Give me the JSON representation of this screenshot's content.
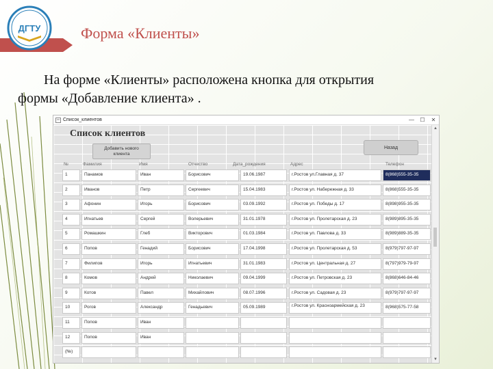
{
  "slide": {
    "logo_text": "ДГТУ",
    "title": "Форма «Клиенты»",
    "body_line1": "На форме «Клиенты» расположена кнопка для открытия",
    "body_line2": "формы «Добавление клиента» ."
  },
  "window": {
    "title": "Список_клиентов",
    "controls": {
      "minimize": "—",
      "maximize": "☐",
      "close": "✕"
    }
  },
  "form": {
    "caption": "Список клиентов",
    "add_button": "Добавить нового клиента",
    "back_button": "Назад",
    "columns": [
      "№",
      "Фамилия",
      "Имя",
      "Отчество",
      "Дата_рождения",
      "Адрес",
      "Телефон"
    ],
    "rows": [
      [
        "1",
        "Панамов",
        "Иван",
        "Борисович",
        "19.06.1987",
        "г.Ростов ул.Главная д. 37",
        "8(868)555-35-35"
      ],
      [
        "2",
        "Иванов",
        "Петр",
        "Сергеевич",
        "15.04.1983",
        "г.Ростов ул. Набережная д. 33",
        "8(868)555-35-35"
      ],
      [
        "3",
        "Афонин",
        "Игорь",
        "Борисович",
        "03.09.1992",
        "г.Ростов ул. Победы д. 17",
        "8(898)955-35-35"
      ],
      [
        "4",
        "Игнатьев",
        "Сергей",
        "Волерьевич",
        "31.01.1978",
        "г.Ростов ул. Пролетарская д. 23",
        "8(989)895-35-35"
      ],
      [
        "5",
        "Ромашкин",
        "Глеб",
        "Викторович",
        "01.03.1984",
        "г.Ростов ул. Павлова д. 33",
        "8(989)889-35-35"
      ],
      [
        "6",
        "Попов",
        "Генадий",
        "Борисович",
        "17.04.1998",
        "г.Ростов ул. Пролетарская д. 53",
        "8(979)797-97-97"
      ],
      [
        "7",
        "Филипов",
        "Игорь",
        "Игнатьевич",
        "31.01.1983",
        "г.Ростов ул. Центральная д. 27",
        "8(797)979-79-97"
      ],
      [
        "8",
        "Комов",
        "Андрей",
        "Николаевич",
        "09.04.1999",
        "г.Ростов ул. Петровская д. 23",
        "8(868)646-84-46"
      ],
      [
        "9",
        "Котов",
        "Павел",
        "Михайлович",
        "08.07.1996",
        "г.Ростов ул. Садовая д. 23",
        "8(979)797-97-97"
      ],
      [
        "10",
        "Рогов",
        "Александр",
        "Генадьевич",
        "05.09.1989",
        "г.Ростов ул. Красноармейская д. 23",
        "8(968)575-77-58"
      ],
      [
        "11",
        "Попов",
        "Иван",
        "",
        "",
        "",
        ""
      ],
      [
        "12",
        "Попов",
        "Иван",
        "",
        "",
        "",
        ""
      ],
      [
        "(№)",
        "",
        "",
        "",
        "",
        "",
        ""
      ]
    ]
  },
  "colors": {
    "title": "#c0504d",
    "accent_red": "#c0504d",
    "olive": "#7a8a2e",
    "selected_cell": "#1f2d5c"
  },
  "icons": [
    "logo-emblem",
    "scroll-up-icon",
    "scroll-down-icon"
  ]
}
